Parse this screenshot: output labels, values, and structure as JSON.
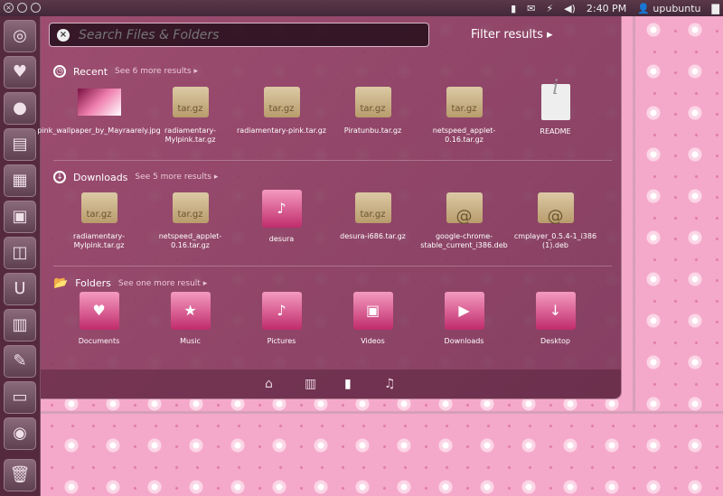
{
  "panel": {
    "time": "2:40 PM",
    "user": "upubuntu",
    "indicators": [
      "battery-icon",
      "mail-icon",
      "network-icon",
      "volume-icon",
      "user-icon",
      "display-icon"
    ]
  },
  "launcher": {
    "items": [
      "ubuntu-logo-icon",
      "heart-app-icon",
      "firefox-icon",
      "writer-icon",
      "calc-icon",
      "impress-icon",
      "software-center-icon",
      "ubuntu-one-icon",
      "workspaces-icon",
      "settings-icon",
      "terminal-icon",
      "disc-icon",
      "trash-icon"
    ]
  },
  "search": {
    "placeholder": "Search Files & Folders",
    "clear_icon": "close-icon"
  },
  "filter": {
    "label": "Filter results"
  },
  "sections": [
    {
      "title": "Recent",
      "more": "See 6 more results",
      "items": [
        {
          "label": "pink_wallpaper_by_Mayraarely.jpg",
          "type": "image"
        },
        {
          "label": "radiamentary-Mylpink.tar.gz",
          "type": "tar.gz"
        },
        {
          "label": "radiamentary-pink.tar.gz",
          "type": "tar.gz"
        },
        {
          "label": "Piratunbu.tar.gz",
          "type": "tar.gz"
        },
        {
          "label": "netspeed_applet-0.16.tar.gz",
          "type": "tar.gz"
        },
        {
          "label": "README",
          "type": "doc"
        }
      ]
    },
    {
      "title": "Downloads",
      "more": "See 5 more results",
      "items": [
        {
          "label": "radiamentary-Mylpink.tar.gz",
          "type": "tar.gz"
        },
        {
          "label": "netspeed_applet-0.16.tar.gz",
          "type": "tar.gz"
        },
        {
          "label": "desura",
          "type": "folder"
        },
        {
          "label": "desura-i686.tar.gz",
          "type": "tar.gz"
        },
        {
          "label": "google-chrome-stable_current_i386.deb",
          "type": "deb"
        },
        {
          "label": "cmplayer_0.5.4-1_i386 (1).deb",
          "type": "deb"
        }
      ]
    },
    {
      "title": "Folders",
      "more": "See one more result",
      "items": [
        {
          "label": "Documents",
          "type": "folder"
        },
        {
          "label": "Music",
          "type": "folder"
        },
        {
          "label": "Pictures",
          "type": "folder"
        },
        {
          "label": "Videos",
          "type": "folder"
        },
        {
          "label": "Downloads",
          "type": "folder"
        },
        {
          "label": "Desktop",
          "type": "folder"
        }
      ]
    }
  ],
  "box_text": "tar.gz",
  "lenses": [
    "home-lens",
    "applications-lens",
    "files-lens",
    "music-lens"
  ]
}
